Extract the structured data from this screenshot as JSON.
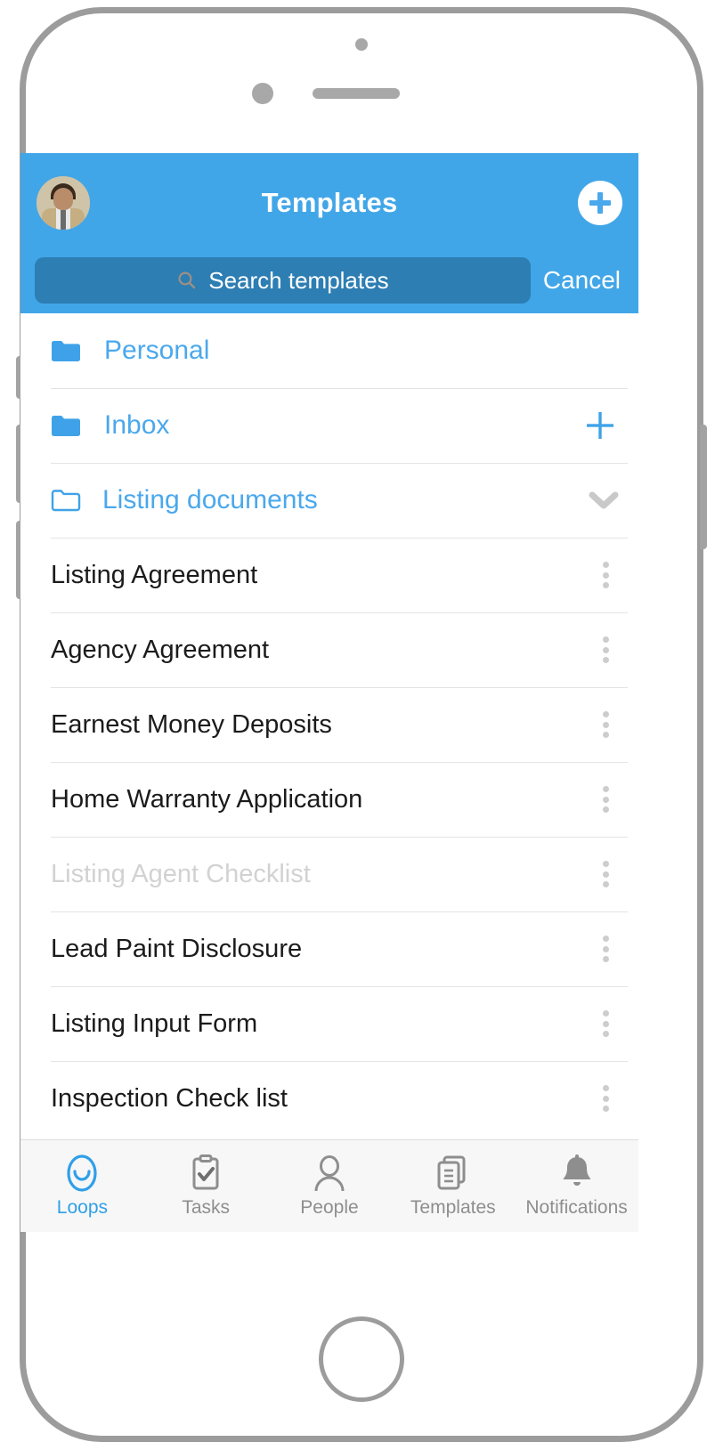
{
  "device": {
    "frame": "iphone",
    "sensor_icon": "proximity-sensor-dot",
    "camera_icon": "front-camera-dot",
    "speaker_icon": "earpiece-speaker",
    "home_button_icon": "home-button"
  },
  "colors": {
    "header_blue": "#41a6e8",
    "search_field_blue": "#2d7eb3",
    "accent_blue": "#4aa8ec",
    "tab_active_blue": "#2f9fe8",
    "tab_inactive_gray": "#8e8e8e",
    "dimmed_text": "#d2d2d2",
    "divider": "#e4e4e4",
    "tab_bar_bg": "#f7f7f7"
  },
  "header": {
    "title": "Templates",
    "avatar_name": "user-avatar",
    "add_button_icon": "plus-circle-icon",
    "add_button_label": "+"
  },
  "search": {
    "icon": "search-icon",
    "placeholder": "Search templates",
    "value": "",
    "cancel_label": "Cancel"
  },
  "folders": [
    {
      "label": "Personal",
      "icon": "folder-filled-icon",
      "expanded": false,
      "accessory": "none"
    },
    {
      "label": "Inbox",
      "icon": "folder-filled-icon",
      "expanded": false,
      "accessory": "plus"
    },
    {
      "label": "Listing documents",
      "icon": "folder-outline-icon",
      "expanded": true,
      "accessory": "chevron-down"
    }
  ],
  "documents": [
    {
      "label": "Listing Agreement",
      "dimmed": false,
      "menu_icon": "kebab-menu-icon"
    },
    {
      "label": "Agency Agreement",
      "dimmed": false,
      "menu_icon": "kebab-menu-icon"
    },
    {
      "label": "Earnest Money Deposits",
      "dimmed": false,
      "menu_icon": "kebab-menu-icon"
    },
    {
      "label": "Home Warranty Application",
      "dimmed": false,
      "menu_icon": "kebab-menu-icon"
    },
    {
      "label": "Listing Agent Checklist",
      "dimmed": true,
      "menu_icon": "kebab-menu-icon"
    },
    {
      "label": "Lead Paint Disclosure",
      "dimmed": false,
      "menu_icon": "kebab-menu-icon"
    },
    {
      "label": "Listing Input Form",
      "dimmed": false,
      "menu_icon": "kebab-menu-icon"
    },
    {
      "label": "Inspection Check list",
      "dimmed": false,
      "menu_icon": "kebab-menu-icon"
    }
  ],
  "tabs": [
    {
      "label": "Loops",
      "icon": "loops-icon",
      "active": true
    },
    {
      "label": "Tasks",
      "icon": "clipboard-check-icon",
      "active": false
    },
    {
      "label": "People",
      "icon": "person-icon",
      "active": false
    },
    {
      "label": "Templates",
      "icon": "documents-copy-icon",
      "active": false
    },
    {
      "label": "Notifications",
      "icon": "bell-icon",
      "active": false
    }
  ]
}
